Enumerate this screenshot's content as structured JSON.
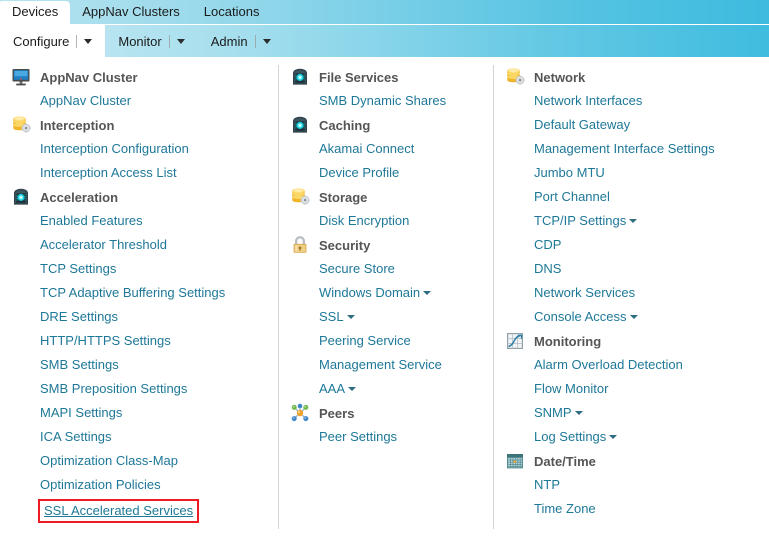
{
  "topbar": {
    "tabs": [
      {
        "label": "Devices",
        "active": true
      },
      {
        "label": "AppNav Clusters",
        "active": false
      },
      {
        "label": "Locations",
        "active": false
      }
    ]
  },
  "menubar": {
    "items": [
      {
        "label": "Configure",
        "active": true
      },
      {
        "label": "Monitor",
        "active": false
      },
      {
        "label": "Admin",
        "active": false
      }
    ]
  },
  "columns": [
    {
      "groups": [
        {
          "title": "AppNav Cluster",
          "icon": "monitor-icon",
          "links": [
            {
              "label": "AppNav Cluster",
              "caret": false,
              "highlighted": false
            }
          ]
        },
        {
          "title": "Interception",
          "icon": "database-gear-icon",
          "links": [
            {
              "label": "Interception Configuration",
              "caret": false,
              "highlighted": false
            },
            {
              "label": "Interception Access List",
              "caret": false,
              "highlighted": false
            }
          ]
        },
        {
          "title": "Acceleration",
          "icon": "chip-icon",
          "links": [
            {
              "label": "Enabled Features",
              "caret": false,
              "highlighted": false
            },
            {
              "label": "Accelerator Threshold",
              "caret": false,
              "highlighted": false
            },
            {
              "label": "TCP Settings",
              "caret": false,
              "highlighted": false
            },
            {
              "label": "TCP Adaptive Buffering Settings",
              "caret": false,
              "highlighted": false
            },
            {
              "label": "DRE Settings",
              "caret": false,
              "highlighted": false
            },
            {
              "label": "HTTP/HTTPS Settings",
              "caret": false,
              "highlighted": false
            },
            {
              "label": "SMB Settings",
              "caret": false,
              "highlighted": false
            },
            {
              "label": "SMB Preposition Settings",
              "caret": false,
              "highlighted": false
            },
            {
              "label": "MAPI Settings",
              "caret": false,
              "highlighted": false
            },
            {
              "label": "ICA Settings",
              "caret": false,
              "highlighted": false
            },
            {
              "label": "Optimization Class-Map",
              "caret": false,
              "highlighted": false
            },
            {
              "label": "Optimization Policies",
              "caret": false,
              "highlighted": false
            },
            {
              "label": "SSL Accelerated Services",
              "caret": false,
              "highlighted": true
            }
          ]
        }
      ]
    },
    {
      "groups": [
        {
          "title": "File Services",
          "icon": "chip-icon",
          "links": [
            {
              "label": "SMB Dynamic Shares",
              "caret": false,
              "highlighted": false
            }
          ]
        },
        {
          "title": "Caching",
          "icon": "chip-icon",
          "links": [
            {
              "label": "Akamai Connect",
              "caret": false,
              "highlighted": false
            },
            {
              "label": "Device Profile",
              "caret": false,
              "highlighted": false
            }
          ]
        },
        {
          "title": "Storage",
          "icon": "database-gear-icon",
          "links": [
            {
              "label": "Disk Encryption",
              "caret": false,
              "highlighted": false
            }
          ]
        },
        {
          "title": "Security",
          "icon": "lock-icon",
          "links": [
            {
              "label": "Secure Store",
              "caret": false,
              "highlighted": false
            },
            {
              "label": "Windows Domain",
              "caret": true,
              "highlighted": false
            },
            {
              "label": "SSL",
              "caret": true,
              "highlighted": false
            },
            {
              "label": "Peering Service",
              "caret": false,
              "highlighted": false
            },
            {
              "label": "Management Service",
              "caret": false,
              "highlighted": false
            },
            {
              "label": "AAA",
              "caret": true,
              "highlighted": false
            }
          ]
        },
        {
          "title": "Peers",
          "icon": "network-hub-icon",
          "links": [
            {
              "label": "Peer Settings",
              "caret": false,
              "highlighted": false
            }
          ]
        }
      ]
    },
    {
      "groups": [
        {
          "title": "Network",
          "icon": "database-gear-icon",
          "links": [
            {
              "label": "Network Interfaces",
              "caret": false,
              "highlighted": false
            },
            {
              "label": "Default Gateway",
              "caret": false,
              "highlighted": false
            },
            {
              "label": "Management Interface Settings",
              "caret": false,
              "highlighted": false
            },
            {
              "label": "Jumbo MTU",
              "caret": false,
              "highlighted": false
            },
            {
              "label": "Port Channel",
              "caret": false,
              "highlighted": false
            },
            {
              "label": "TCP/IP Settings",
              "caret": true,
              "highlighted": false
            },
            {
              "label": "CDP",
              "caret": false,
              "highlighted": false
            },
            {
              "label": "DNS",
              "caret": false,
              "highlighted": false
            },
            {
              "label": "Network Services",
              "caret": false,
              "highlighted": false
            },
            {
              "label": "Console Access",
              "caret": true,
              "highlighted": false
            }
          ]
        },
        {
          "title": "Monitoring",
          "icon": "chart-icon",
          "links": [
            {
              "label": "Alarm Overload Detection",
              "caret": false,
              "highlighted": false
            },
            {
              "label": "Flow Monitor",
              "caret": false,
              "highlighted": false
            },
            {
              "label": "SNMP",
              "caret": true,
              "highlighted": false
            },
            {
              "label": "Log Settings",
              "caret": true,
              "highlighted": false
            }
          ]
        },
        {
          "title": "Date/Time",
          "icon": "calendar-icon",
          "links": [
            {
              "label": "NTP",
              "caret": false,
              "highlighted": false
            },
            {
              "label": "Time Zone",
              "caret": false,
              "highlighted": false
            }
          ]
        }
      ]
    }
  ],
  "colors": {
    "link": "#1e7898",
    "group_title": "#555555",
    "highlight_border": "#ee1b22",
    "header_start": "#b8e4ef",
    "header_end": "#3dbbdf"
  }
}
